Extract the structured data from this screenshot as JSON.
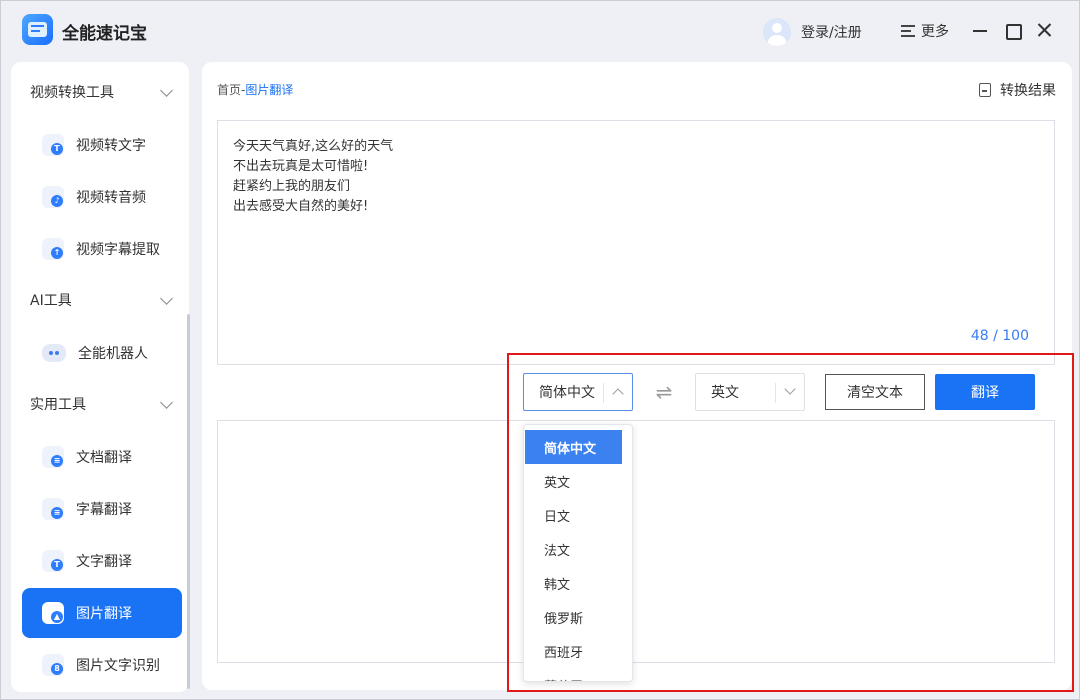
{
  "app": {
    "title": "全能速记宝"
  },
  "header": {
    "login_label": "登录/注册",
    "more_label": "更多"
  },
  "sidebar": {
    "sections": [
      {
        "label": "视频转换工具",
        "items": [
          "视频转文字",
          "视频转音频",
          "视频字幕提取"
        ]
      },
      {
        "label": "AI工具",
        "items": [
          "全能机器人"
        ]
      },
      {
        "label": "实用工具",
        "items": [
          "文档翻译",
          "字幕翻译",
          "文字翻译",
          "图片翻译",
          "图片文字识别"
        ]
      }
    ],
    "active_item": "图片翻译"
  },
  "main": {
    "breadcrumb": {
      "home": "首页",
      "separator": "-",
      "current": "图片翻译"
    },
    "convert_result_label": "转换结果",
    "source_text_lines": [
      "今天天气真好,这么好的天气",
      "不出去玩真是太可惜啦!",
      "赶紧约上我的朋友们",
      "出去感受大自然的美好!"
    ],
    "char_counter": "48 / 100",
    "source_language": "简体中文",
    "target_language": "英文",
    "swap_symbol": "⇌",
    "clear_button": "清空文本",
    "translate_button": "翻译",
    "language_options": [
      "简体中文",
      "英文",
      "日文",
      "法文",
      "韩文",
      "俄罗斯",
      "西班牙",
      "葡萄牙"
    ],
    "selected_option": "简体中文"
  },
  "colors": {
    "accent": "#1a72f5",
    "highlight": "#e01818"
  }
}
